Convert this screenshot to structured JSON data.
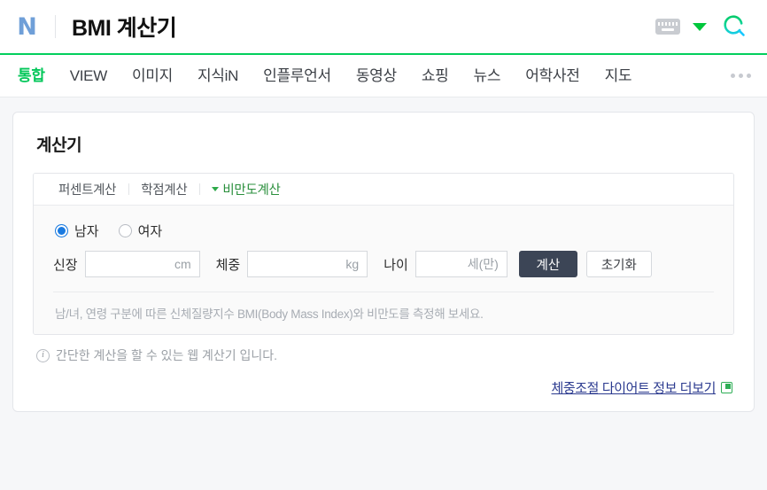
{
  "header": {
    "logo_text": "N",
    "logo_icon": "naver-logo-icon",
    "title": "BMI 계산기",
    "keyboard_icon": "keyboard-icon",
    "caret_icon": "chevron-down-icon",
    "search_icon": "search-icon"
  },
  "nav": {
    "items": [
      {
        "label": "통합",
        "active": true
      },
      {
        "label": "VIEW",
        "active": false
      },
      {
        "label": "이미지",
        "active": false
      },
      {
        "label": "지식iN",
        "active": false
      },
      {
        "label": "인플루언서",
        "active": false
      },
      {
        "label": "동영상",
        "active": false
      },
      {
        "label": "쇼핑",
        "active": false
      },
      {
        "label": "뉴스",
        "active": false
      },
      {
        "label": "어학사전",
        "active": false
      },
      {
        "label": "지도",
        "active": false
      }
    ],
    "more_icon": "more-options-icon"
  },
  "card": {
    "title": "계산기",
    "tabs": [
      {
        "label": "퍼센트계산",
        "active": false
      },
      {
        "label": "학점계산",
        "active": false
      },
      {
        "label": "비만도계산",
        "active": true
      }
    ],
    "gender": {
      "options": [
        {
          "label": "남자",
          "checked": true
        },
        {
          "label": "여자",
          "checked": false
        }
      ]
    },
    "fields": [
      {
        "label": "신장",
        "value": "",
        "unit": "cm"
      },
      {
        "label": "체중",
        "value": "",
        "unit": "kg"
      },
      {
        "label": "나이",
        "value": "",
        "unit": "세(만)"
      }
    ],
    "calculate_label": "계산",
    "reset_label": "초기화",
    "note": "남/녀, 연령 구분에 따른 신체질량지수 BMI(Body Mass Index)와 비만도를 측정해 보세요.",
    "footer_info": "간단한 계산을 할 수 있는 웹 계산기 입니다.",
    "info_icon": "info-icon",
    "more_link": "체중조절 다이어트 정보 더보기",
    "more_link_icon": "external-link-icon"
  },
  "colors": {
    "naver_green": "#03c75a",
    "link_blue": "#2b3a8f",
    "primary_button": "#3c4556",
    "radio_blue": "#1a7ae0",
    "page_bg": "#f6f7f9"
  }
}
